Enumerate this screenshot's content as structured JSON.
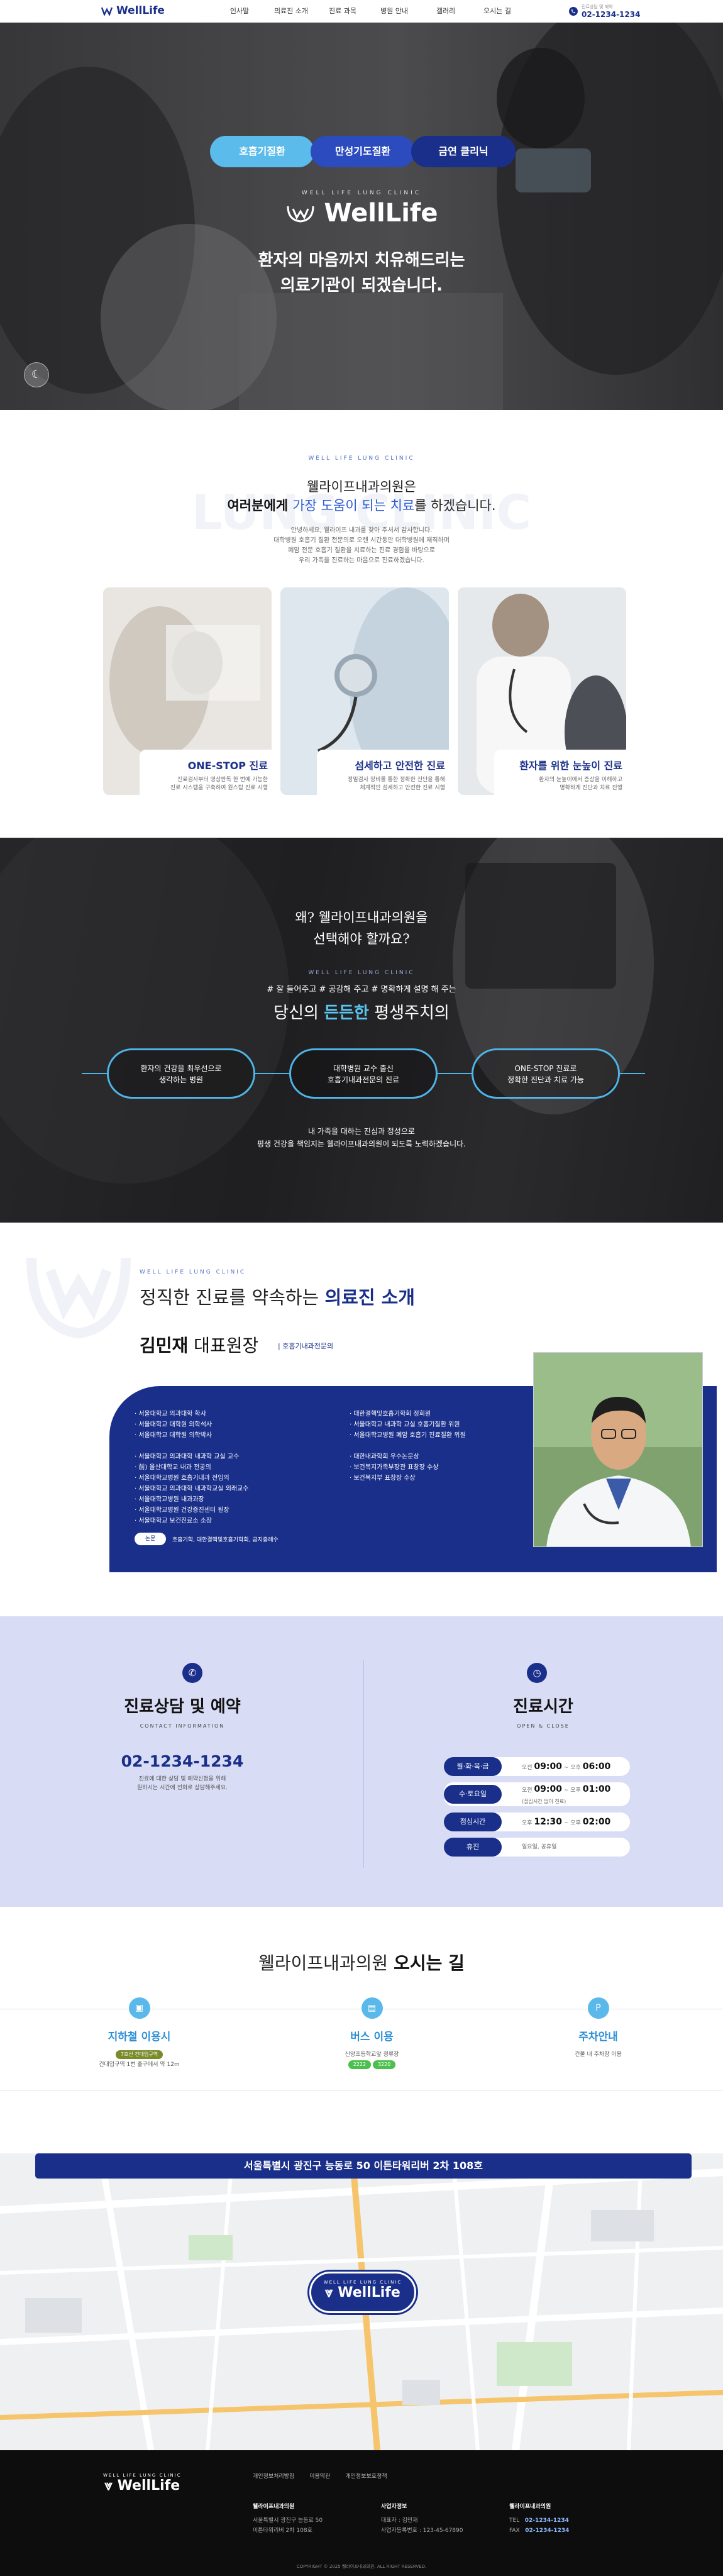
{
  "header": {
    "logo": "WellLife",
    "nav": [
      "인사말",
      "의료진 소개",
      "진료 과목",
      "병원 안내",
      "갤러리",
      "오시는 길"
    ],
    "tel_label": "진료상담 및 예약",
    "tel": "02-1234-1234"
  },
  "hero": {
    "pills": [
      "호흡기질환",
      "만성기도질환",
      "금연 클리닉"
    ],
    "logo_small": "WELL LIFE LUNG CLINIC",
    "logo": "WellLife",
    "headline_1": "환자의 마음까지 치유해드리는",
    "headline_2": "의료기관이 되겠습니다.",
    "colors": {
      "pill1": "#5bbbea",
      "pill2": "#2b4bbf",
      "pill3": "#1a2f8a"
    }
  },
  "intro": {
    "eyebrow": "WELL LIFE LUNG CLINIC",
    "watermark": "LUNG CLINIC",
    "sub": "웰라이프내과의원은",
    "h2_pre": "여러분에게 ",
    "h2_accent": "가장 도움이 되는 치료",
    "h2_post": "를 하겠습니다.",
    "para": [
      "안녕하세요, 웰라이프 내과를 찾아 주셔서 감사합니다.",
      "대학병원 호흡기 질환 전문의로 오랜 시간동안 대학병원에 재직하며",
      "폐암 전문 호흡기 질환을 치료하는 진료 경험을 바탕으로",
      "우리 가족을 진료하는 마음으로 진료하겠습니다."
    ],
    "cards": [
      {
        "title": "ONE-STOP 진료",
        "desc": [
          "진료검사부터 영상판독 한 번에 가능한",
          "진료 시스템을 구축하여 원스탑 진료 시행"
        ]
      },
      {
        "title": "섬세하고 안전한 진료",
        "desc": [
          "정밀검사 장비를 통한 정확한 진단을 통해",
          "체계적인 섬세하고 안전한 진료 시행"
        ]
      },
      {
        "title": "환자를 위한 눈높이 진료",
        "desc": [
          "환자의 눈높이에서 증상을 이해하고",
          "명확하게 진단과 치료 진행"
        ]
      }
    ]
  },
  "why": {
    "h2_1": "왜? 웰라이프내과의원을",
    "h2_2": "선택해야 할까요?",
    "eyebrow": "WELL LIFE LUNG CLINIC",
    "tags": "# 잘 들어주고  # 공감해 주고  # 명확하게 설명 해 주는",
    "h3_pre": "당신의 ",
    "h3_accent": "든든한",
    "h3_post": " 평생주치의",
    "pills": [
      [
        "환자의 건강을 최우선으로",
        "생각하는 병원"
      ],
      [
        "대학병원 교수 출신",
        "호흡기내과전문의 진료"
      ],
      [
        "ONE-STOP 진료로",
        "정확한 진단과 치료 가능"
      ]
    ],
    "foot_1": "내 가족을 대하는 진심과 정성으로",
    "foot_2": "평생 건강을 책임지는 웰라이프내과의원이 되도록 노력하겠습니다."
  },
  "doctor": {
    "eyebrow": "WELL LIFE LUNG CLINIC",
    "title_pre": "정직한 진료를 약속하는 ",
    "title_accent": "의료진 소개",
    "name": "김민재",
    "role": " 대표원장",
    "spec": "호흡기내과전문의",
    "career_left_1": [
      "서울대학교 의과대학 학사",
      "서울대학교 대학원 의학석사",
      "서울대학교 대학원 의학박사"
    ],
    "career_left_2": [
      "서울대학교 의과대학 내과학 교실 교수",
      "前) 울산대학교 내과 전공의",
      "서울대학교병원 호흡기내과 전임의",
      "서울대학교 의과대학 내과학교실 외래교수",
      "서울대학교병원 내과과장",
      "서울대학교병원 건강증진센터 원장",
      "서울대학교 보건진료소 소장"
    ],
    "career_right_1": [
      "대한결핵및호흡기학회 정회원",
      "서울대학교 내과학 교실 호흡기질환 위원",
      "서울대학교병원 폐암 호흡기 진료질환 위원"
    ],
    "career_right_2": [
      "대한내과학회 우수논문상",
      "보건복지가족부장관 표창장 수상",
      "보건복지부 표창장 수상"
    ],
    "pill": "논문",
    "pill_text": "호흡기학, 대한결핵및호흡기학회, 금지증례수"
  },
  "consult": {
    "title": "진료상담 및 예약",
    "sub": "CONTACT INFORMATION",
    "tel": "02-1234-1234",
    "desc_1": "진료에 대한 상담 및 예약신청을 위해",
    "desc_2": "원하시는 시간에 전화로 상담해주세요.",
    "hours_title": "진료시간",
    "hours_sub": "OPEN & CLOSE",
    "hours": [
      {
        "label": "월·화·목·금",
        "pre": "오전",
        "start": "09:00",
        "mid": "~ 오후",
        "end": "06:00",
        "note": ""
      },
      {
        "label": "수·토요일",
        "pre": "오전",
        "start": "09:00",
        "mid": "~ 오후",
        "end": "01:00",
        "note": "(점심시간 없이 진료)"
      },
      {
        "label": "점심시간",
        "pre": "오후",
        "start": "12:30",
        "mid": "~ 오후",
        "end": "02:00",
        "note": ""
      },
      {
        "label": "휴진",
        "pre": "",
        "start": "",
        "mid": "",
        "end": "일요일, 공휴일",
        "note": ""
      }
    ]
  },
  "directions": {
    "title_pre": "웰라이프내과의원 ",
    "title_bold": "오시는 길",
    "cols": [
      {
        "title": "지하철 이용시",
        "badge": "7호선 건대입구역",
        "desc": "건대입구역 1번 출구에서 약 12m"
      },
      {
        "title": "버스 이용",
        "badge": "",
        "desc": "신양초등학교앞 정류장",
        "badges": [
          "2222",
          "3220"
        ]
      },
      {
        "title": "주차안내",
        "badge": "",
        "desc": "건물 내 주차장 이용"
      }
    ],
    "address": "서울특별시 광진구 능동로 50 이튼타워리버 2차 108호",
    "map_logo_small": "WELL LIFE LUNG CLINIC",
    "map_logo": "WellLife"
  },
  "footer": {
    "logo_small": "WELL LIFE LUNG CLINIC",
    "logo": "WellLife",
    "links": [
      "개인정보처리방침",
      "이용약관",
      "개인정보보호정책"
    ],
    "col1_title": "웰라이프내과의원",
    "col1": [
      "서울특별시 광진구 능동로 50",
      "이튼타워리버 2차 108호"
    ],
    "col2_title": "사업자정보",
    "col2": [
      "대표자 : 김민재",
      "사업자등록번호 : 123-45-67890"
    ],
    "col3_title": "웰라이프내과의원",
    "tel_label": "TEL",
    "tel": "02-1234-1234",
    "fax_label": "FAX",
    "fax": "02-1234-1234",
    "copyright": "COPYRIGHT © 2025 웰라이프내과의원. ALL RIGHT RESERVED."
  }
}
